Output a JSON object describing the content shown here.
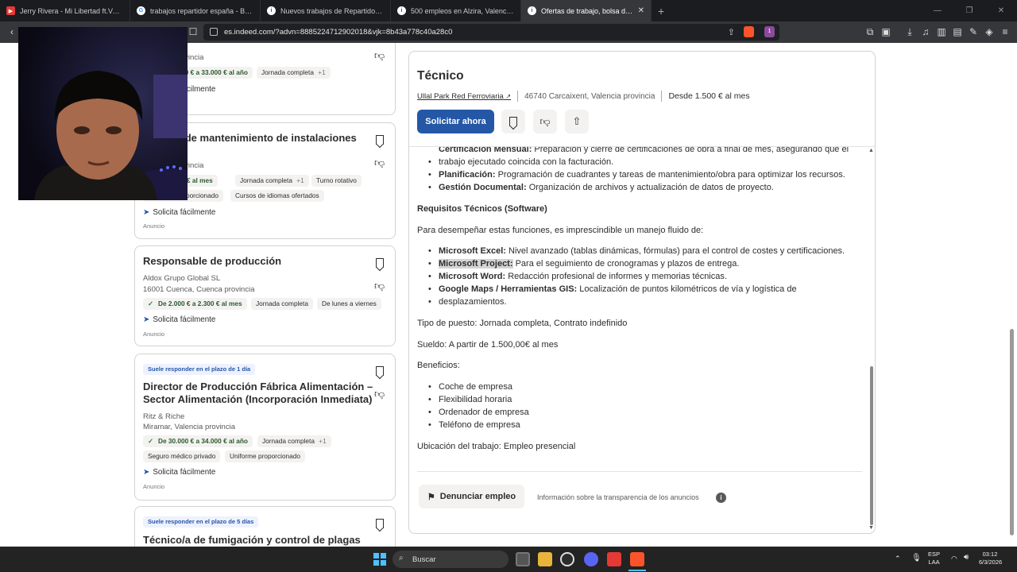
{
  "browser": {
    "tabs": [
      {
        "title": "Jerry Rivera - Mi Libertad ft.Voltio",
        "color": "#e53935"
      },
      {
        "title": "trabajos repartidor españa - Buscar con Google",
        "color": "#888"
      },
      {
        "title": "Nuevos trabajos de Repartidor en Alzira",
        "color": "#888"
      },
      {
        "title": "500 empleos en Alzira, Valencia provincia",
        "color": "#888"
      },
      {
        "title": "Ofertas de trabajo, bolsa de trabajo",
        "color": "#888"
      }
    ],
    "new_tab": "+",
    "url": "es.indeed.com/?advn=8885224712902018&vjk=8b43a778c40a28c0",
    "brave_badge": "1"
  },
  "cards": {
    "c1": {
      "location": "Valencia provincia",
      "salary": "De 30.000 € a 33.000 € al año",
      "chip2": "Jornada completa",
      "plus": "+1",
      "easy": "Solicita fácilmente"
    },
    "c2": {
      "title": "Técnico de mantenimiento de instalaciones",
      "location": "Valencia provincia",
      "salary": "De 1.400 € al mes",
      "chip2": "Jornada completa",
      "plus": "+1",
      "chip3": "Turno rotativo",
      "chip4": "Uniforme proporcionado",
      "chip5": "Cursos de idiomas ofertados",
      "easy": "Solicita fácilmente",
      "ad": "Anuncio"
    },
    "c3": {
      "title": "Responsable de producción",
      "company": "Aldox Grupo Global SL",
      "location": "16001 Cuenca, Cuenca provincia",
      "salary": "De 2.000 € a 2.300 € al mes",
      "chip2": "Jornada completa",
      "chip3": "De lunes a viernes",
      "easy": "Solicita fácilmente",
      "ad": "Anuncio"
    },
    "c4": {
      "badge": "Suele responder en el plazo de 1 día",
      "title1": "Director de Producción Fábrica Alimentación –",
      "title2": "Sector Alimentación (Incorporación Inmediata)",
      "company": "Ritz & Riche",
      "location": "Miramar, Valencia provincia",
      "salary": "De 30.000 € a 34.000 € al año",
      "chip2": "Jornada completa",
      "plus": "+1",
      "chip3": "Seguro médico privado",
      "chip4": "Uniforme proporcionado",
      "easy": "Solicita fácilmente",
      "ad": "Anuncio"
    },
    "c5": {
      "badge": "Suele responder en el plazo de 5 días",
      "title": "Técnico/a de fumigación y control de plagas"
    }
  },
  "detail": {
    "title": "Técnico",
    "company": "Ullal Park Red Ferroviaria",
    "location": "46740 Carcaixent, Valencia provincia",
    "salary": "Desde 1.500 € al mes",
    "apply": "Solicitar ahora",
    "cert_label": "Certificación Mensual:",
    "cert_text": "Preparación y cierre de certificaciones de obra a final de mes, asegurando que el",
    "cert_text2": "trabajo ejecutado coincida con la facturación.",
    "plan_label": "Planificación:",
    "plan_text": "Programación de cuadrantes y tareas de mantenimiento/obra para optimizar los recursos.",
    "doc_label": "Gestión Documental:",
    "doc_text": "Organización de archivos y actualización de datos de proyecto.",
    "req_heading": "Requisitos Técnicos (Software)",
    "req_intro": "Para desempeñar estas funciones, es imprescindible un manejo fluido de:",
    "excel_label": "Microsoft Excel:",
    "excel_text": "Nivel avanzado (tablas dinámicas, fórmulas) para el control de costes y certificaciones.",
    "project_label": "Microsoft Project:",
    "project_text": "Para el seguimiento de cronogramas y plazos de entrega.",
    "word_label": "Microsoft Word:",
    "word_text": "Redacción profesional de informes y memorias técnicas.",
    "gmaps_label": "Google Maps / Herramientas GIS:",
    "gmaps_text": "Localización de puntos kilométricos de vía y logística de",
    "gmaps_text2": "desplazamientos.",
    "tipo": "Tipo de puesto: Jornada completa, Contrato indefinido",
    "sueldo": "Sueldo: A partir de 1.500,00€ al mes",
    "beneficios": "Beneficios:",
    "benefits": [
      "Coche de empresa",
      "Flexibilidad horaria",
      "Ordenador de empresa",
      "Teléfono de empresa"
    ],
    "ubicacion": "Ubicación del trabajo: Empleo presencial",
    "report": "Denunciar empleo",
    "transparency": "Información sobre la transparencia de los anuncios"
  },
  "taskbar": {
    "search": "Buscar",
    "lang1": "ESP",
    "lang2": "LAA",
    "time": "03:12",
    "date": "6/3/2026"
  }
}
